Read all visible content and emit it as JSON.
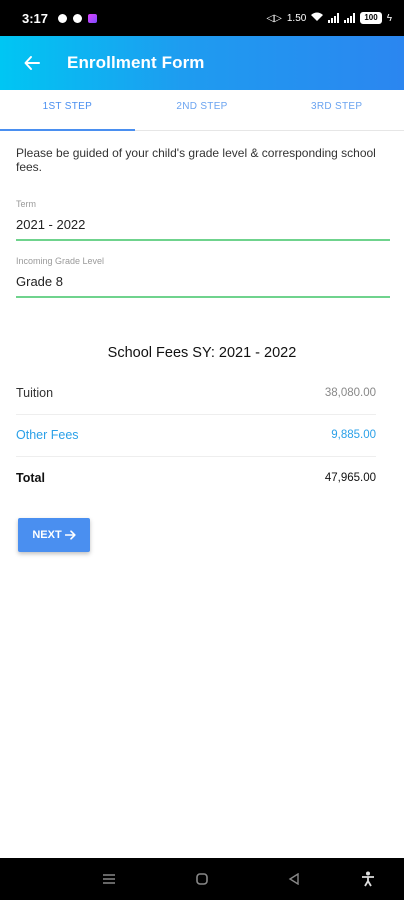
{
  "status_bar": {
    "time": "3:17",
    "net_speed": "1.50",
    "battery": "100"
  },
  "app_bar": {
    "title": "Enrollment Form",
    "back_icon": "arrow-left-icon"
  },
  "tabs": [
    {
      "label": "1ST STEP",
      "active": true
    },
    {
      "label": "2ND STEP",
      "active": false
    },
    {
      "label": "3RD STEP",
      "active": false
    }
  ],
  "intro_text": "Please be guided of your child's grade level & corresponding school fees.",
  "form": {
    "term": {
      "label": "Term",
      "value": "2021 - 2022"
    },
    "grade": {
      "label": "Incoming Grade Level",
      "value": "Grade 8"
    }
  },
  "fees": {
    "title": "School Fees SY: 2021 - 2022",
    "rows": [
      {
        "label": "Tuition",
        "amount": "38,080.00"
      },
      {
        "label": "Other Fees",
        "amount": "9,885.00"
      },
      {
        "label": "Total",
        "amount": "47,965.00"
      }
    ]
  },
  "next_button": {
    "label": "NEXT"
  },
  "colors": {
    "accent": "#4a8ff0",
    "app_bar_start": "#00c6f3",
    "app_bar_end": "#2b86f0",
    "field_underline": "#6fd38d",
    "link": "#2aa0e8"
  }
}
